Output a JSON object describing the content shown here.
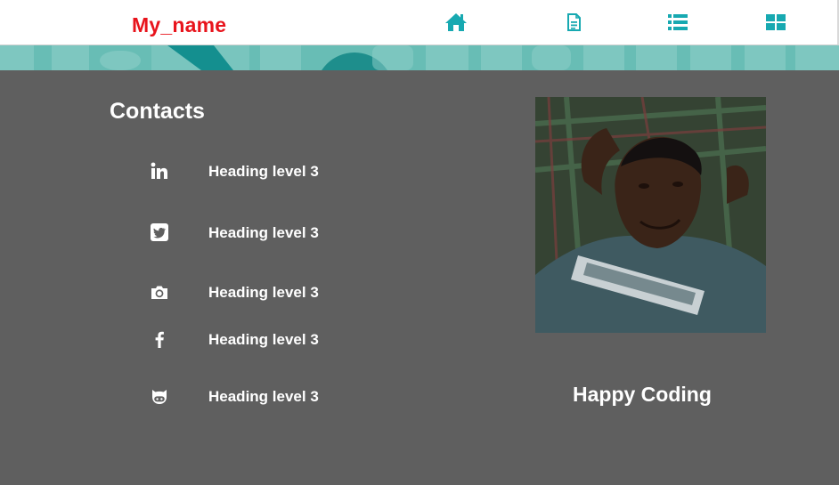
{
  "brand": {
    "name": "My_name",
    "color": "#e8141c"
  },
  "nav": {
    "accent_color": "#17a9b1",
    "items": [
      {
        "icon": "home-icon"
      },
      {
        "icon": "file-text-icon"
      },
      {
        "icon": "list-icon"
      },
      {
        "icon": "grid-icon"
      }
    ]
  },
  "contacts": {
    "title": "Contacts",
    "items": [
      {
        "icon": "linkedin-icon",
        "label": "Heading level 3"
      },
      {
        "icon": "twitter-icon",
        "label": "Heading level 3"
      },
      {
        "icon": "camera-icon",
        "label": "Heading level 3"
      },
      {
        "icon": "facebook-icon",
        "label": "Heading level 3"
      },
      {
        "icon": "github-icon",
        "label": "Heading level 3"
      }
    ]
  },
  "profile": {
    "tagline": "Happy Coding"
  },
  "colors": {
    "background": "#5f5f5f",
    "banner": "#68bdb5",
    "text": "#ffffff"
  }
}
